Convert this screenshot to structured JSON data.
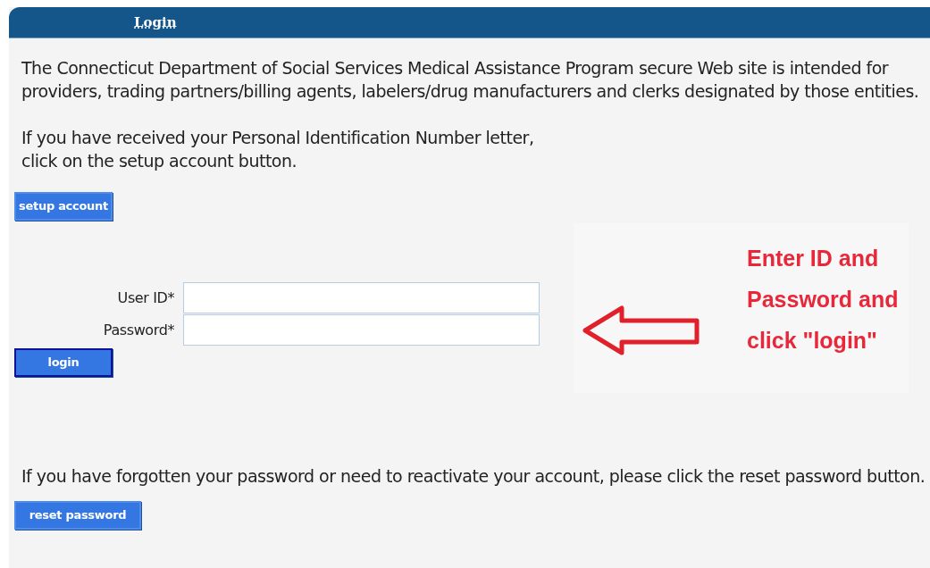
{
  "header": {
    "title": "Login"
  },
  "intro": "The Connecticut Department of Social Services Medical Assistance Program secure Web site is intended for providers, trading partners/billing agents, labelers/drug manufacturers and clerks designated by those entities.",
  "setup_text": [
    "If you have received your Personal Identification Number letter,",
    "click on the setup account button."
  ],
  "setup_button": {
    "label": "setup account",
    "focused": false
  },
  "fields": [
    {
      "label": "User ID*"
    },
    {
      "label": "Password*"
    }
  ],
  "login_button": {
    "label": "login",
    "focused": true
  },
  "annotation": {
    "lines": [
      "Enter ID and",
      "Password and",
      "click \"login\""
    ]
  },
  "reset_text": "If you have forgotten your password or need to reactivate your account, please click the reset password button.",
  "reset_button": {
    "label": "reset password",
    "focused": false
  }
}
